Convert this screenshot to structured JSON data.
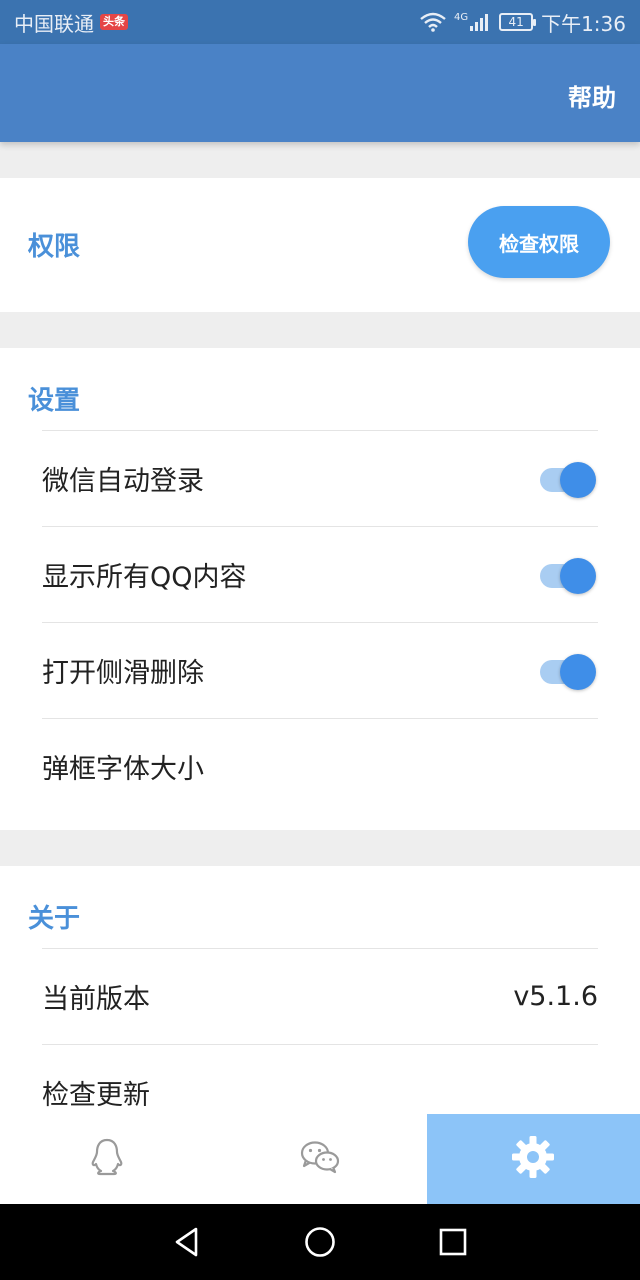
{
  "status_bar": {
    "carrier": "中国联通",
    "badge": "头条",
    "network": "4G",
    "battery": "41",
    "time": "下午1:36"
  },
  "app_bar": {
    "help_label": "帮助"
  },
  "permission": {
    "title": "权限",
    "check_button": "检查权限"
  },
  "settings": {
    "title": "设置",
    "items": [
      {
        "label": "微信自动登录",
        "toggle": true,
        "enabled": true
      },
      {
        "label": "显示所有QQ内容",
        "toggle": true,
        "enabled": true
      },
      {
        "label": "打开侧滑删除",
        "toggle": true,
        "enabled": true
      },
      {
        "label": "弹框字体大小",
        "toggle": false
      }
    ]
  },
  "about": {
    "title": "关于",
    "items": [
      {
        "label": "当前版本",
        "value": "v5.1.6"
      },
      {
        "label": "检查更新",
        "value": ""
      }
    ]
  },
  "bottom_nav": {
    "items": [
      {
        "icon": "qq-penguin-icon",
        "active": false
      },
      {
        "icon": "wechat-icon",
        "active": false
      },
      {
        "icon": "gear-icon",
        "active": true
      }
    ]
  },
  "colors": {
    "status_bar": "#3b73b0",
    "app_bar": "#4a82c6",
    "accent": "#4a90d9",
    "button": "#4aa0f0",
    "active_tab": "#8cc4f8"
  }
}
